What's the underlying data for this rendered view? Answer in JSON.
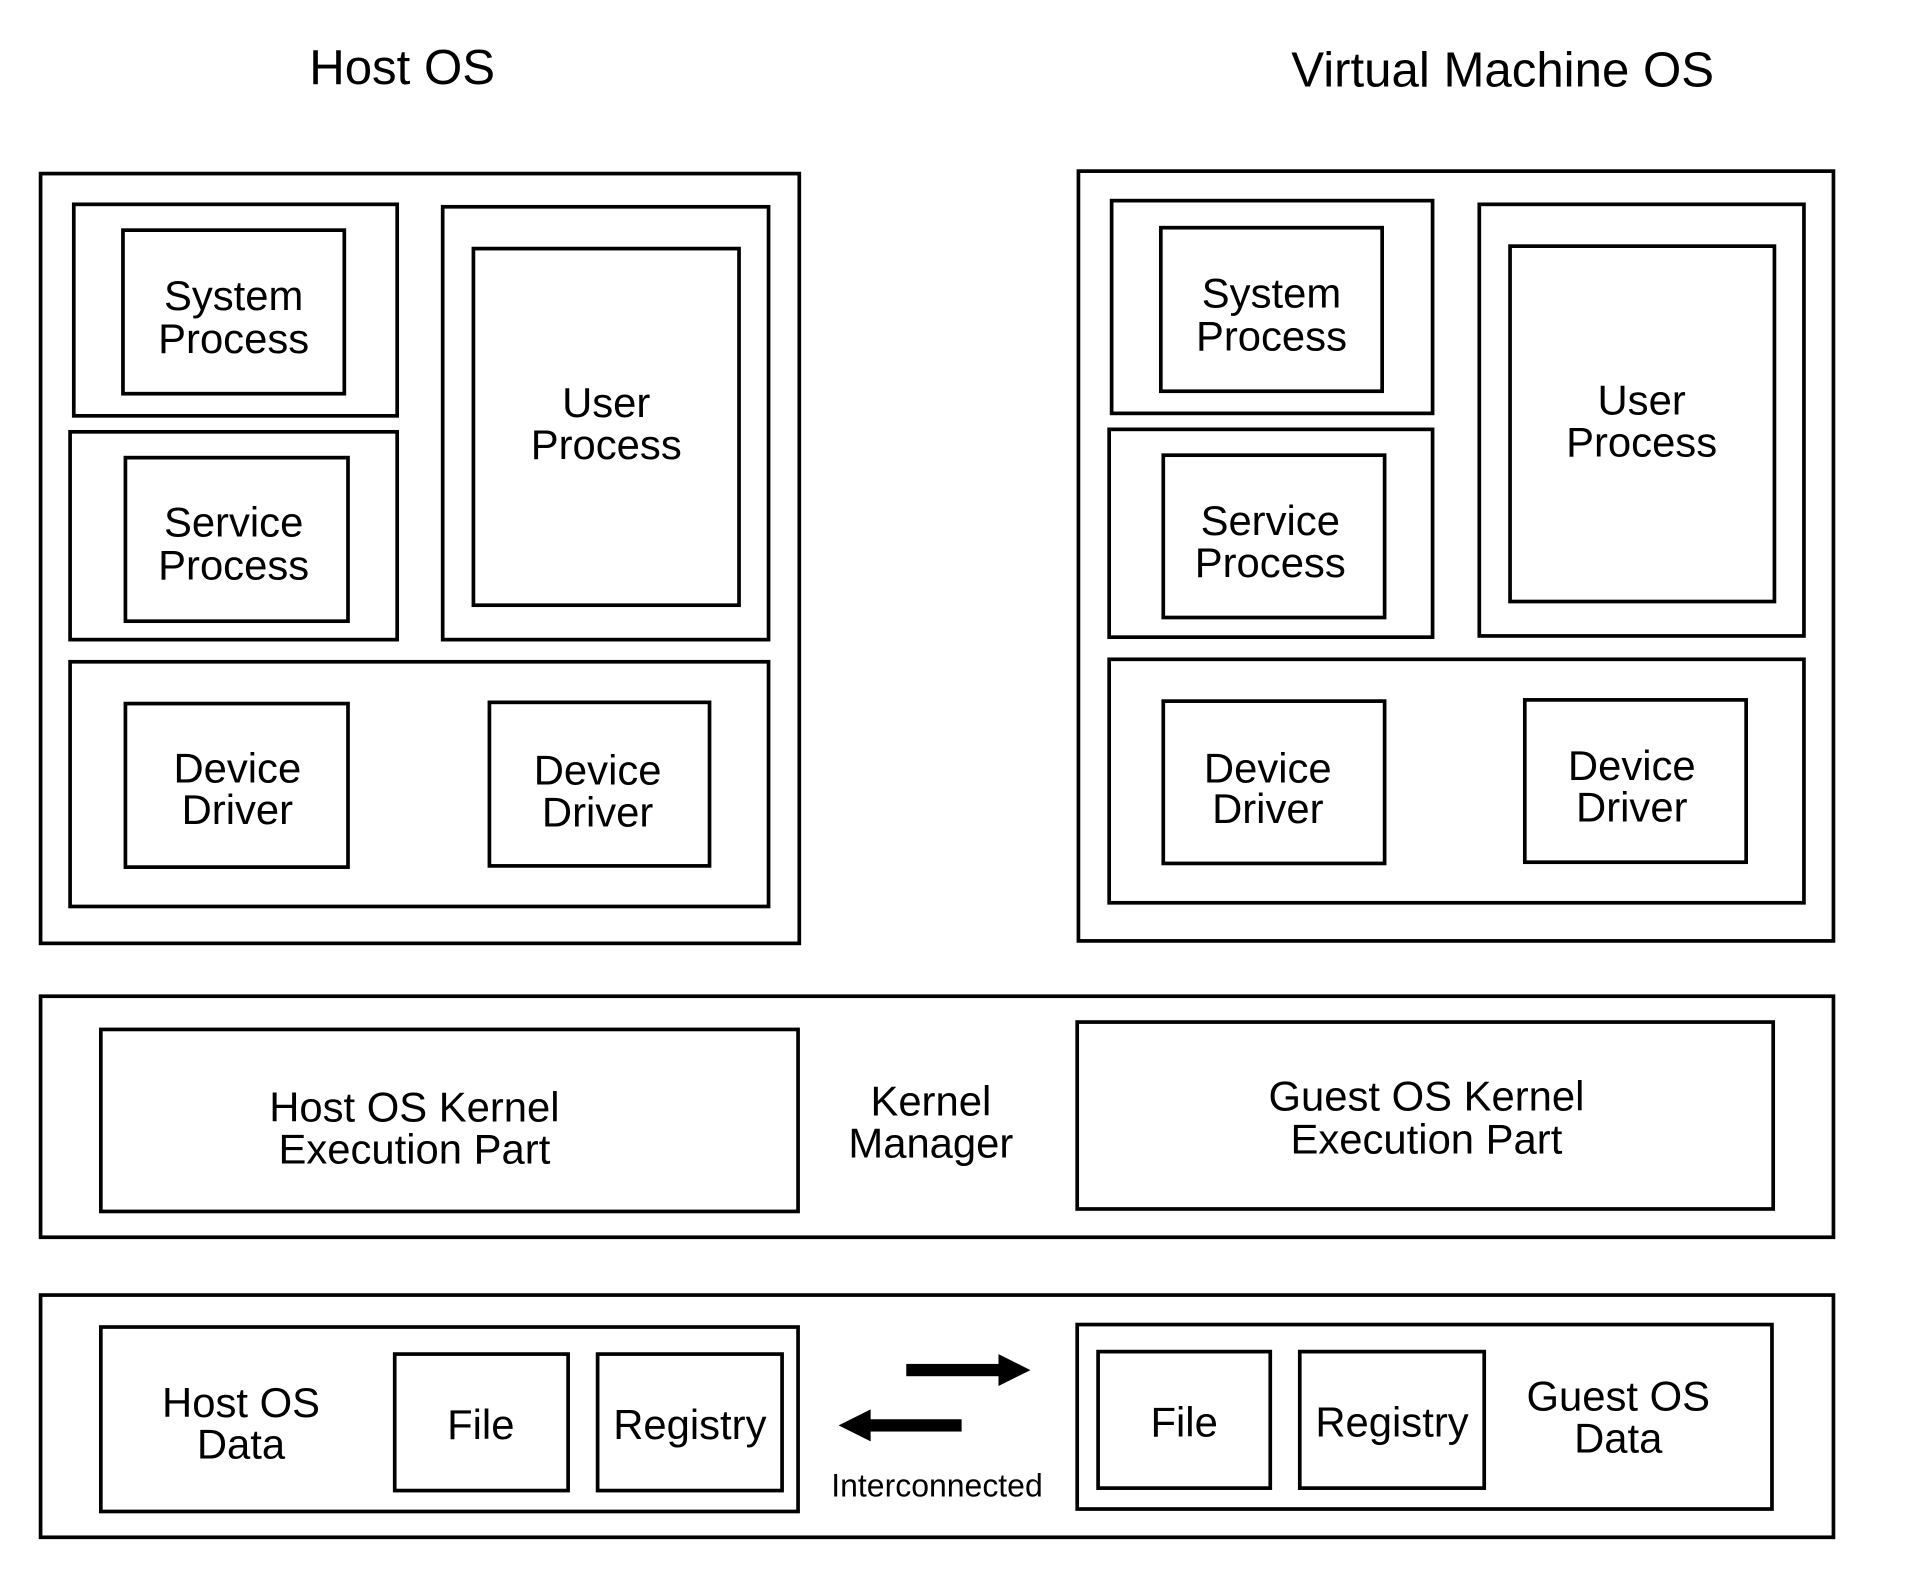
{
  "titles": {
    "host": "Host OS",
    "vm": "Virtual Machine OS"
  },
  "host": {
    "system_process": [
      "System",
      "Process"
    ],
    "service_process": [
      "Service",
      "Process"
    ],
    "user_process": [
      "User",
      "Process"
    ],
    "device_driver_1": [
      "Device",
      "Driver"
    ],
    "device_driver_2": [
      "Device",
      "Driver"
    ]
  },
  "vm": {
    "system_process": [
      "System",
      "Process"
    ],
    "service_process": [
      "Service",
      "Process"
    ],
    "user_process": [
      "User",
      "Process"
    ],
    "device_driver_1": [
      "Device",
      "Driver"
    ],
    "device_driver_2": [
      "Device",
      "Driver"
    ]
  },
  "kernel": {
    "host_exec": [
      "Host OS Kernel",
      "Execution Part"
    ],
    "manager": [
      "Kernel",
      "Manager"
    ],
    "guest_exec": [
      "Guest OS Kernel",
      "Execution Part"
    ]
  },
  "data": {
    "host_label": [
      "Host OS",
      "Data"
    ],
    "host_file": "File",
    "host_registry": "Registry",
    "guest_file": "File",
    "guest_registry": "Registry",
    "guest_label": [
      "Guest OS",
      "Data"
    ],
    "interconnected": "Interconnected"
  }
}
